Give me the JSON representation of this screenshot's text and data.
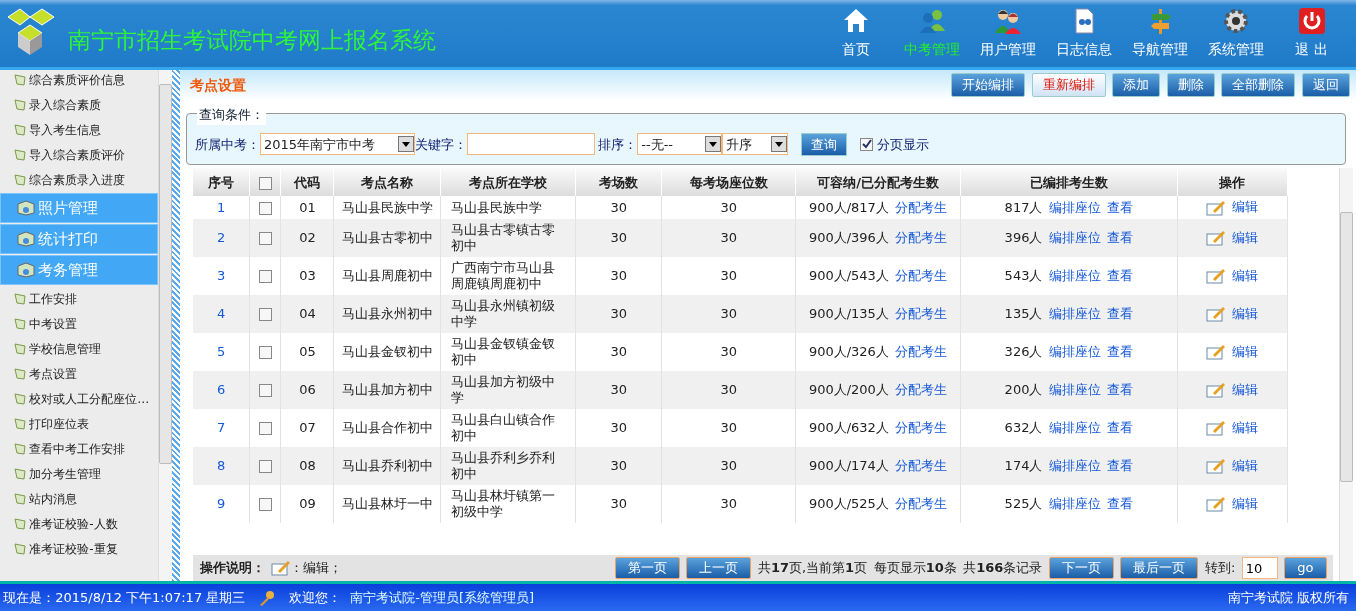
{
  "header": {
    "title": "南宁市招生考试院中考网上报名系统",
    "nav": [
      {
        "label": "首页",
        "selected": false
      },
      {
        "label": "中考管理",
        "selected": true
      },
      {
        "label": "用户管理",
        "selected": false
      },
      {
        "label": "日志信息",
        "selected": false
      },
      {
        "label": "导航管理",
        "selected": false
      },
      {
        "label": "系统管理",
        "selected": false
      },
      {
        "label": "退 出",
        "selected": false
      }
    ]
  },
  "sidebar": {
    "items": [
      {
        "kind": "link",
        "label": "综合素质评价信息"
      },
      {
        "kind": "link",
        "label": "录入综合素质"
      },
      {
        "kind": "link",
        "label": "导入考生信息"
      },
      {
        "kind": "link",
        "label": "导入综合素质评价"
      },
      {
        "kind": "link",
        "label": "综合素质录入进度"
      },
      {
        "kind": "section",
        "label": "照片管理"
      },
      {
        "kind": "section",
        "label": "统计打印"
      },
      {
        "kind": "section",
        "label": "考务管理"
      },
      {
        "kind": "link",
        "label": "工作安排"
      },
      {
        "kind": "link",
        "label": "中考设置"
      },
      {
        "kind": "link",
        "label": "学校信息管理"
      },
      {
        "kind": "link",
        "label": "考点设置"
      },
      {
        "kind": "link",
        "label": "校对或人工分配座位…"
      },
      {
        "kind": "link",
        "label": "打印座位表"
      },
      {
        "kind": "link",
        "label": "查看中考工作安排"
      },
      {
        "kind": "link",
        "label": "加分考生管理"
      },
      {
        "kind": "link",
        "label": "站内消息"
      },
      {
        "kind": "link",
        "label": "准考证校验-人数"
      },
      {
        "kind": "link",
        "label": "准考证校验-重复"
      }
    ]
  },
  "page_title": "考点设置",
  "toolbar": [
    {
      "label": "开始编排",
      "kind": "normal"
    },
    {
      "label": "重新编排",
      "kind": "alert"
    },
    {
      "label": "添加",
      "kind": "normal"
    },
    {
      "label": "删除",
      "kind": "normal"
    },
    {
      "label": "全部删除",
      "kind": "normal"
    },
    {
      "label": "返回",
      "kind": "normal"
    }
  ],
  "query": {
    "legend": "查询条件：",
    "exam_label": "所属中考：",
    "exam_value": "2015年南宁市中考",
    "keyword_label": "关键字：",
    "sort_label": "排序：",
    "sort_value": "--无--",
    "order_value": "升序",
    "search_button": "查询",
    "paging": {
      "label": "分页显示",
      "checked": true
    }
  },
  "table": {
    "columns": [
      "序号",
      "代码",
      "考点名称",
      "考点所在学校",
      "考场数",
      "每考场座位数",
      "可容纳/已分配考生数",
      "已编排考生数",
      "操作"
    ],
    "header_checked": false,
    "rows": [
      {
        "index": "1",
        "checked": false,
        "code": "01",
        "name": "马山县民族中学",
        "school": "马山县民族中学",
        "rooms": "30",
        "seats": "30",
        "capacity": "900人/817人",
        "assign": "分配考生",
        "arranged": "817人",
        "arrange": "编排座位",
        "view": "查看",
        "edit": "编辑"
      },
      {
        "index": "2",
        "checked": false,
        "code": "02",
        "name": "马山县古零初中",
        "school": "马山县古零镇古零初中",
        "rooms": "30",
        "seats": "30",
        "capacity": "900人/396人",
        "assign": "分配考生",
        "arranged": "396人",
        "arrange": "编排座位",
        "view": "查看",
        "edit": "编辑"
      },
      {
        "index": "3",
        "checked": false,
        "code": "03",
        "name": "马山县周鹿初中",
        "school": "广西南宁市马山县周鹿镇周鹿初中",
        "rooms": "30",
        "seats": "30",
        "capacity": "900人/543人",
        "assign": "分配考生",
        "arranged": "543人",
        "arrange": "编排座位",
        "view": "查看",
        "edit": "编辑"
      },
      {
        "index": "4",
        "checked": false,
        "code": "04",
        "name": "马山县永州初中",
        "school": "马山县永州镇初级中学",
        "rooms": "30",
        "seats": "30",
        "capacity": "900人/135人",
        "assign": "分配考生",
        "arranged": "135人",
        "arrange": "编排座位",
        "view": "查看",
        "edit": "编辑"
      },
      {
        "index": "5",
        "checked": false,
        "code": "05",
        "name": "马山县金钗初中",
        "school": "马山县金钗镇金钗初中",
        "rooms": "30",
        "seats": "30",
        "capacity": "900人/326人",
        "assign": "分配考生",
        "arranged": "326人",
        "arrange": "编排座位",
        "view": "查看",
        "edit": "编辑"
      },
      {
        "index": "6",
        "checked": false,
        "code": "06",
        "name": "马山县加方初中",
        "school": "马山县加方初级中学",
        "rooms": "30",
        "seats": "30",
        "capacity": "900人/200人",
        "assign": "分配考生",
        "arranged": "200人",
        "arrange": "编排座位",
        "view": "查看",
        "edit": "编辑"
      },
      {
        "index": "7",
        "checked": false,
        "code": "07",
        "name": "马山县合作初中",
        "school": "马山县白山镇合作初中",
        "rooms": "30",
        "seats": "30",
        "capacity": "900人/632人",
        "assign": "分配考生",
        "arranged": "632人",
        "arrange": "编排座位",
        "view": "查看",
        "edit": "编辑"
      },
      {
        "index": "8",
        "checked": false,
        "code": "08",
        "name": "马山县乔利初中",
        "school": "马山县乔利乡乔利初中",
        "rooms": "30",
        "seats": "30",
        "capacity": "900人/174人",
        "assign": "分配考生",
        "arranged": "174人",
        "arrange": "编排座位",
        "view": "查看",
        "edit": "编辑"
      },
      {
        "index": "9",
        "checked": false,
        "code": "09",
        "name": "马山县林圩一中",
        "school": "马山县林圩镇第一初级中学",
        "rooms": "30",
        "seats": "30",
        "capacity": "900人/525人",
        "assign": "分配考生",
        "arranged": "525人",
        "arrange": "编排座位",
        "view": "查看",
        "edit": "编辑"
      }
    ]
  },
  "pager": {
    "legend_label": "操作说明：",
    "legend_text": "：编辑；",
    "first": "第一页",
    "prev": "上一页",
    "pages": "共**17**页,当前第**1**页",
    "per_page": "每页显示**10**条",
    "total": "共**166**条记录",
    "next": "下一页",
    "last": "最后一页",
    "goto_label": "转到:",
    "goto_value": "10",
    "go": "go"
  },
  "status_bar": {
    "time": "现在是：2015/8/12 下午1:07:17 星期三",
    "welcome": "欢迎您：",
    "user": "南宁考试院-管理员[系统管理员]",
    "copyright": "南宁考试院 版权所有"
  }
}
